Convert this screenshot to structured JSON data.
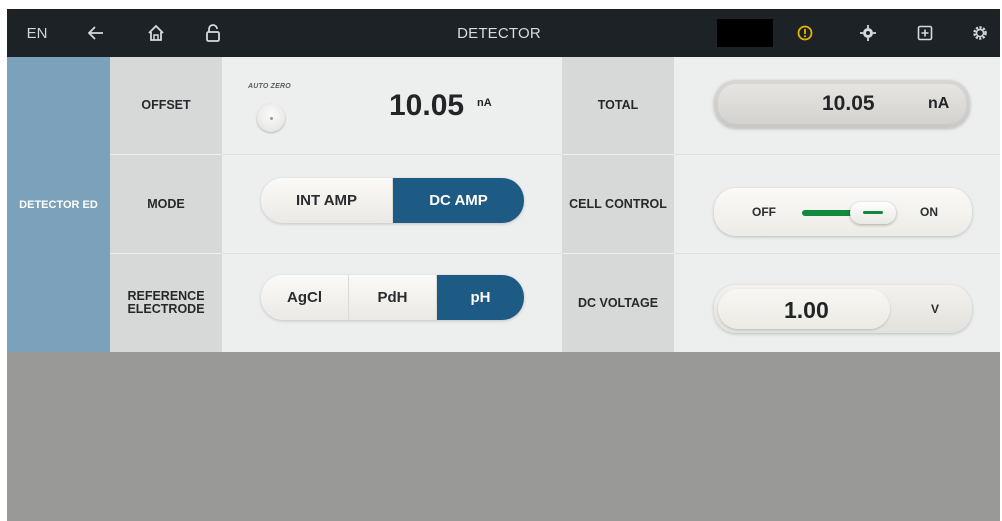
{
  "header": {
    "language": "EN",
    "title": "DETECTOR",
    "icons": [
      "back-arrow-icon",
      "home-icon",
      "unlock-icon",
      "alert-icon",
      "target-icon",
      "plus-box-icon",
      "gear-icon"
    ],
    "alert_color": "#e8b200"
  },
  "sidebar": {
    "label": "DETECTOR ED",
    "color": "#7ba2ba"
  },
  "offset": {
    "label": "OFFSET",
    "auto_zero_label": "AUTO ZERO",
    "value": "10.05",
    "unit": "nA"
  },
  "mode": {
    "label": "MODE",
    "options": [
      "INT AMP",
      "DC AMP"
    ],
    "selected": "DC AMP"
  },
  "reference": {
    "label": "REFERENCE ELECTRODE",
    "options": [
      "AgCl",
      "PdH",
      "pH"
    ],
    "selected": "pH"
  },
  "total": {
    "label": "TOTAL",
    "value": "10.05",
    "unit": "nA"
  },
  "cell_control": {
    "label": "CELL CONTROL",
    "off_label": "OFF",
    "on_label": "ON",
    "state": "ON",
    "accent": "#12893c"
  },
  "dc_voltage": {
    "label": "DC VOLTAGE",
    "value": "1.00",
    "unit": "V"
  },
  "colors": {
    "selected_segment": "#1d5a84",
    "topbar": "#1d2226"
  }
}
